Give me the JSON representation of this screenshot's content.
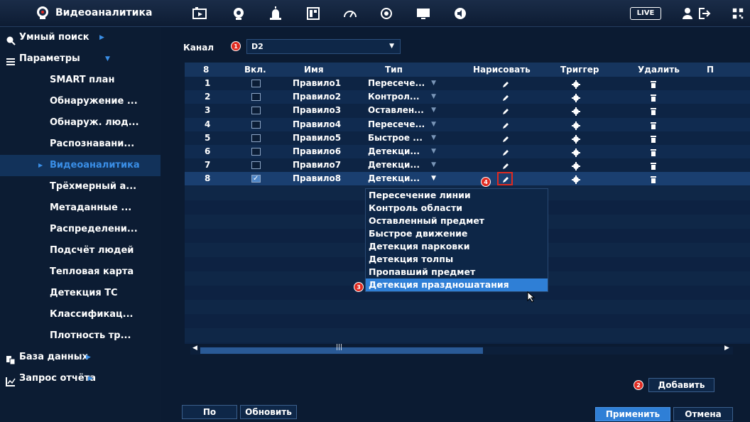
{
  "topbar": {
    "title": "Видеоаналитика",
    "icons": [
      "playback-icon",
      "face-icon",
      "alarm-icon",
      "storage-icon",
      "gauge-icon",
      "record-icon",
      "display-icon",
      "audio-icon"
    ],
    "live_label": "LIVE",
    "right_icons": [
      "user-icon",
      "logout-icon",
      "qr-icon"
    ]
  },
  "sidebar": {
    "smart_search": "Умный поиск",
    "parameters": "Параметры",
    "subitems": [
      "SMART план",
      "Обнаружение ...",
      "Обнаруж. люд...",
      "Распознавани...",
      "Видеоаналитика",
      "Трёхмерный а...",
      "Метаданные ...",
      "Распределени...",
      "Подсчёт людей",
      "Тепловая карта",
      "Детекция ТС",
      "Классификац...",
      "Плотность тр..."
    ],
    "active_index": 4,
    "database": "База данных",
    "report": "Запрос отчёта"
  },
  "channel": {
    "label": "Канал",
    "value": "D2"
  },
  "table": {
    "headers": {
      "num": "8",
      "enable": "Вкл.",
      "name": "Имя",
      "type": "Тип",
      "draw": "Нарисовать",
      "trigger": "Триггер",
      "delete": "Удалить",
      "more": "П"
    },
    "rows": [
      {
        "num": "1",
        "enabled": false,
        "name": "Правило1",
        "type": "Пересече..."
      },
      {
        "num": "2",
        "enabled": false,
        "name": "Правило2",
        "type": "Контрол..."
      },
      {
        "num": "3",
        "enabled": false,
        "name": "Правило3",
        "type": "Оставлен..."
      },
      {
        "num": "4",
        "enabled": false,
        "name": "Правило4",
        "type": "Пересече..."
      },
      {
        "num": "5",
        "enabled": false,
        "name": "Правило5",
        "type": "Быстрое ..."
      },
      {
        "num": "6",
        "enabled": false,
        "name": "Правило6",
        "type": "Детекци..."
      },
      {
        "num": "7",
        "enabled": false,
        "name": "Правило7",
        "type": "Детекци..."
      },
      {
        "num": "8",
        "enabled": true,
        "name": "Правило8",
        "type": "Детекци..."
      }
    ],
    "selected_row": 7
  },
  "dropdown": {
    "options": [
      "Пересечение линии",
      "Контроль области",
      "Оставленный предмет",
      "Быстрое движение",
      "Детекция парковки",
      "Детекция толпы",
      "Пропавший предмет",
      "Детекция праздношатания"
    ],
    "highlighted_index": 7
  },
  "badges": {
    "channel": "1",
    "draw": "4",
    "dropdown": "3",
    "add": "2"
  },
  "buttons": {
    "add": "Добавить",
    "default": "По умолч...",
    "refresh": "Обновить",
    "apply": "Применить",
    "cancel": "Отмена"
  },
  "colors": {
    "accent": "#2f7fd6",
    "badge": "#e02a20",
    "background": "#0a1a30"
  }
}
